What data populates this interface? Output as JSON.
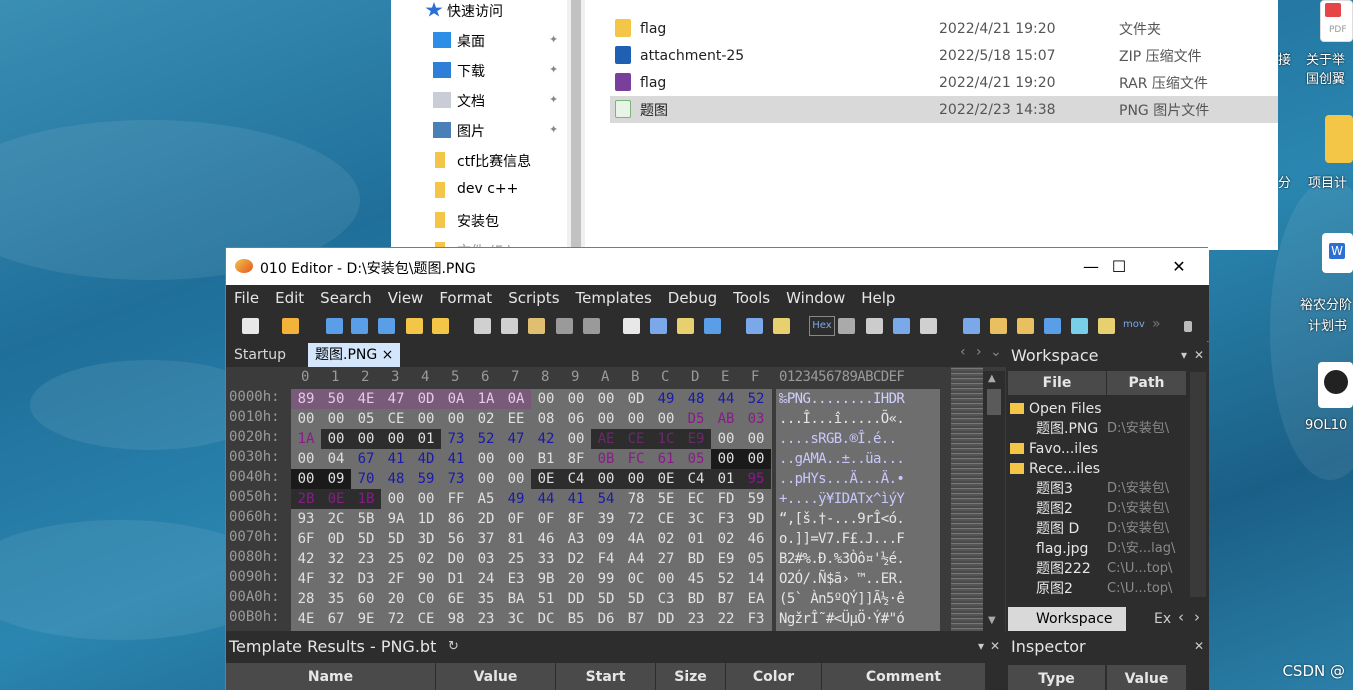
{
  "explorer": {
    "nav_items": [
      {
        "label": "快速访问",
        "icon": "star-icon",
        "pinned": false
      },
      {
        "label": "桌面",
        "icon": "desktop-icon",
        "pinned": true
      },
      {
        "label": "下载",
        "icon": "download-icon",
        "pinned": true
      },
      {
        "label": "文档",
        "icon": "document-icon",
        "pinned": true
      },
      {
        "label": "图片",
        "icon": "picture-icon",
        "pinned": true
      },
      {
        "label": "ctf比赛信息",
        "icon": "folder-icon",
        "pinned": false
      },
      {
        "label": "dev c++",
        "icon": "folder-icon",
        "pinned": false
      },
      {
        "label": "安装包",
        "icon": "folder-icon",
        "pinned": false
      },
      {
        "label": "文件 (F:)",
        "icon": "folder-icon",
        "pinned": false
      }
    ],
    "files": [
      {
        "name": "flag",
        "date": "2022/4/21 19:20",
        "type": "文件夹",
        "icon": "folder-icon",
        "selected": false
      },
      {
        "name": "attachment-25",
        "date": "2022/5/18 15:07",
        "type": "ZIP 压缩文件",
        "icon": "zip-icon",
        "selected": false
      },
      {
        "name": "flag",
        "date": "2022/4/21 19:20",
        "type": "RAR 压缩文件",
        "icon": "rar-icon",
        "selected": false
      },
      {
        "name": "题图",
        "date": "2022/2/23 14:38",
        "type": "PNG 图片文件",
        "icon": "png-file-icon",
        "selected": true
      }
    ]
  },
  "desktop": {
    "icons": [
      {
        "label": "关于举",
        "sub": "国创翼",
        "prefix": "接"
      },
      {
        "label": "项目计",
        "prefix": "分"
      },
      {
        "label": "裕农分阶",
        "sub": "计划书"
      },
      {
        "label": "9OL10"
      }
    ],
    "pdf_label": "PDF"
  },
  "editor": {
    "title": "010 Editor - D:\\安装包\\题图.PNG",
    "menu": [
      "File",
      "Edit",
      "Search",
      "View",
      "Format",
      "Scripts",
      "Templates",
      "Debug",
      "Tools",
      "Window",
      "Help"
    ],
    "tabs": [
      {
        "label": "Startup",
        "active": false
      },
      {
        "label": "题图.PNG",
        "active": true
      }
    ],
    "col_header": [
      "0",
      "1",
      "2",
      "3",
      "4",
      "5",
      "6",
      "7",
      "8",
      "9",
      "A",
      "B",
      "C",
      "D",
      "E",
      "F"
    ],
    "ascii_header": "0123456789ABCDEF",
    "toolbar_hex_label": "Hex",
    "toolbar_mov_label": "mov",
    "rows": [
      {
        "addr": "0000h:",
        "bytes": [
          "89",
          "50",
          "4E",
          "47",
          "0D",
          "0A",
          "1A",
          "0A",
          "00",
          "00",
          "00",
          "0D",
          "49",
          "48",
          "44",
          "52"
        ],
        "ascii": "‰PNG........IHDR"
      },
      {
        "addr": "0010h:",
        "bytes": [
          "00",
          "00",
          "05",
          "CE",
          "00",
          "00",
          "02",
          "EE",
          "08",
          "06",
          "00",
          "00",
          "00",
          "D5",
          "AB",
          "03"
        ],
        "ascii": "...Î...î.....Õ«."
      },
      {
        "addr": "0020h:",
        "bytes": [
          "1A",
          "00",
          "00",
          "00",
          "01",
          "73",
          "52",
          "47",
          "42",
          "00",
          "AE",
          "CE",
          "1C",
          "E9",
          "00",
          "00"
        ],
        "ascii": "....sRGB.®Î.é.."
      },
      {
        "addr": "0030h:",
        "bytes": [
          "00",
          "04",
          "67",
          "41",
          "4D",
          "41",
          "00",
          "00",
          "B1",
          "8F",
          "0B",
          "FC",
          "61",
          "05",
          "00",
          "00"
        ],
        "ascii": "..gAMA..±..üa..."
      },
      {
        "addr": "0040h:",
        "bytes": [
          "00",
          "09",
          "70",
          "48",
          "59",
          "73",
          "00",
          "00",
          "0E",
          "C4",
          "00",
          "00",
          "0E",
          "C4",
          "01",
          "95"
        ],
        "ascii": "..pHYs...Ä...Ä.•"
      },
      {
        "addr": "0050h:",
        "bytes": [
          "2B",
          "0E",
          "1B",
          "00",
          "00",
          "FF",
          "A5",
          "49",
          "44",
          "41",
          "54",
          "78",
          "5E",
          "EC",
          "FD",
          "59"
        ],
        "ascii": "+....ÿ¥IDATx^ìýY"
      },
      {
        "addr": "0060h:",
        "bytes": [
          "93",
          "2C",
          "5B",
          "9A",
          "1D",
          "86",
          "2D",
          "0F",
          "0F",
          "8F",
          "39",
          "72",
          "CE",
          "3C",
          "F3",
          "9D"
        ],
        "ascii": "“,[š.†-...9rÎ<ó."
      },
      {
        "addr": "0070h:",
        "bytes": [
          "6F",
          "0D",
          "5D",
          "5D",
          "3D",
          "56",
          "37",
          "81",
          "46",
          "A3",
          "09",
          "4A",
          "02",
          "01",
          "02",
          "46"
        ],
        "ascii": "o.]]=V7.F£.J...F"
      },
      {
        "addr": "0080h:",
        "bytes": [
          "42",
          "32",
          "23",
          "25",
          "02",
          "D0",
          "03",
          "25",
          "33",
          "D2",
          "F4",
          "A4",
          "27",
          "BD",
          "E9",
          "05"
        ],
        "ascii": "B2#%.Ð.%3Òô¤'½é."
      },
      {
        "addr": "0090h:",
        "bytes": [
          "4F",
          "32",
          "D3",
          "2F",
          "90",
          "D1",
          "24",
          "E3",
          "9B",
          "20",
          "99",
          "0C",
          "00",
          "45",
          "52",
          "14"
        ],
        "ascii": "O2Ó/.Ñ$ã› ™..ER."
      },
      {
        "addr": "00A0h:",
        "bytes": [
          "28",
          "35",
          "60",
          "20",
          "C0",
          "6E",
          "35",
          "BA",
          "51",
          "DD",
          "5D",
          "5D",
          "C3",
          "BD",
          "B7",
          "EA"
        ],
        "ascii": "(5` Àn5ºQÝ]]Ã½·ê"
      },
      {
        "addr": "00B0h:",
        "bytes": [
          "4E",
          "67",
          "9E",
          "72",
          "CE",
          "98",
          "23",
          "3C",
          "DC",
          "B5",
          "D6",
          "B7",
          "DD",
          "23",
          "22",
          "F3"
        ],
        "ascii": "NgžrÎ˜#<ÜµÖ·Ý#\"ó"
      }
    ],
    "workspace": {
      "title": "Workspace",
      "col_file": "File",
      "col_path": "Path",
      "groups": [
        {
          "label": "Open Files",
          "items": [
            {
              "name": "题图.PNG",
              "path": "D:\\安装包\\"
            }
          ]
        },
        {
          "label": "Favo...iles",
          "items": []
        },
        {
          "label": "Rece...iles",
          "items": [
            {
              "name": "题图3",
              "path": "D:\\安装包\\"
            },
            {
              "name": "题图2",
              "path": "D:\\安装包\\"
            },
            {
              "name": "题图 D",
              "path": "D:\\安装包\\"
            },
            {
              "name": "flag.jpg",
              "path": "D:\\安...lag\\"
            },
            {
              "name": "题图222",
              "path": "C:\\U...top\\"
            },
            {
              "name": "原图2",
              "path": "C:\\U...top\\"
            }
          ]
        }
      ],
      "bottom_tabs": [
        "Workspace",
        "Ex"
      ]
    },
    "template_results": {
      "title": "Template Results - PNG.bt",
      "columns": [
        "Name",
        "Value",
        "Start",
        "Size",
        "Color",
        "Comment"
      ]
    },
    "inspector": {
      "title": "Inspector",
      "columns": [
        "Type",
        "Value"
      ]
    }
  },
  "watermark": "CSDN @"
}
